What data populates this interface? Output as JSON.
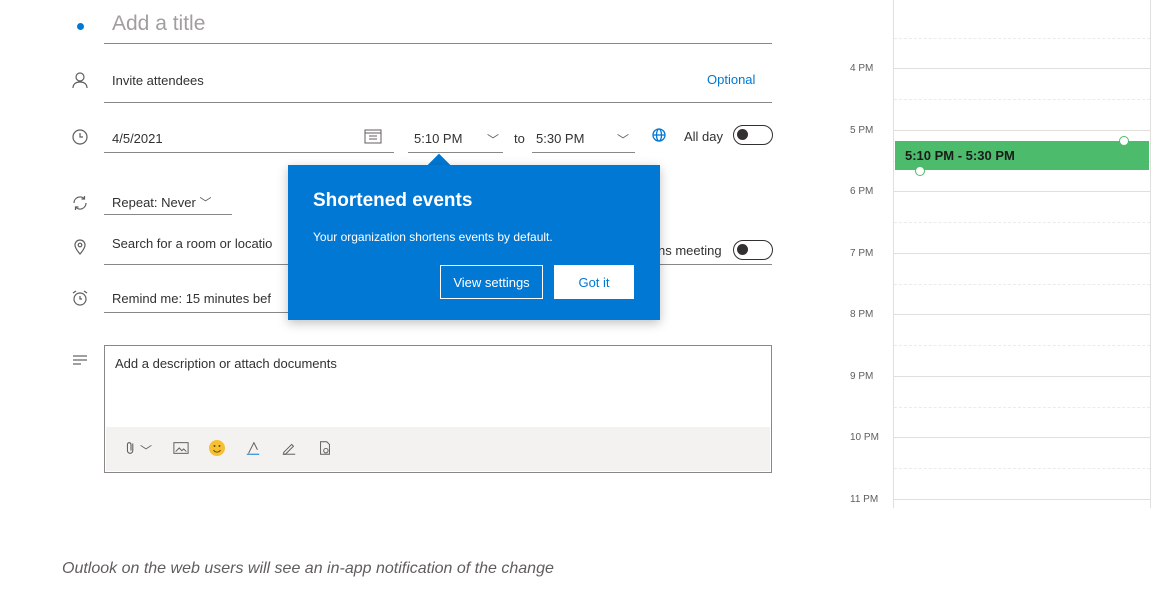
{
  "form": {
    "title_placeholder": "Add a title",
    "attendees_placeholder": "Invite attendees",
    "optional_label": "Optional",
    "date": "4/5/2021",
    "start_time": "5:10 PM",
    "to_label": "to",
    "end_time": "5:30 PM",
    "all_day_label": "All day",
    "repeat_label": "Repeat: Never",
    "location_placeholder": "Search for a room or locatio",
    "teams_meeting_label": "ns meeting",
    "reminder_label": "Remind me: 15 minutes bef",
    "description_placeholder": "Add a description or attach documents"
  },
  "callout": {
    "title": "Shortened events",
    "body": "Your organization shortens events by default.",
    "view_settings_label": "View settings",
    "got_it_label": "Got it"
  },
  "calendar": {
    "hours": [
      "4 PM",
      "5 PM",
      "6 PM",
      "7 PM",
      "8 PM",
      "9 PM",
      "10 PM",
      "11 PM"
    ],
    "event_label": "5:10 PM - 5:30 PM"
  },
  "caption": "Outlook on the web users will see an in-app notification of the change",
  "colors": {
    "accent": "#0078d4",
    "event": "#4cbb6b"
  },
  "icons": {
    "attendees": "person-icon",
    "time": "clock-icon",
    "repeat": "repeat-icon",
    "location": "location-pin-icon",
    "reminder": "alarm-icon",
    "description": "text-lines-icon",
    "date_picker": "calendar-icon",
    "teams": "teams-icon"
  }
}
